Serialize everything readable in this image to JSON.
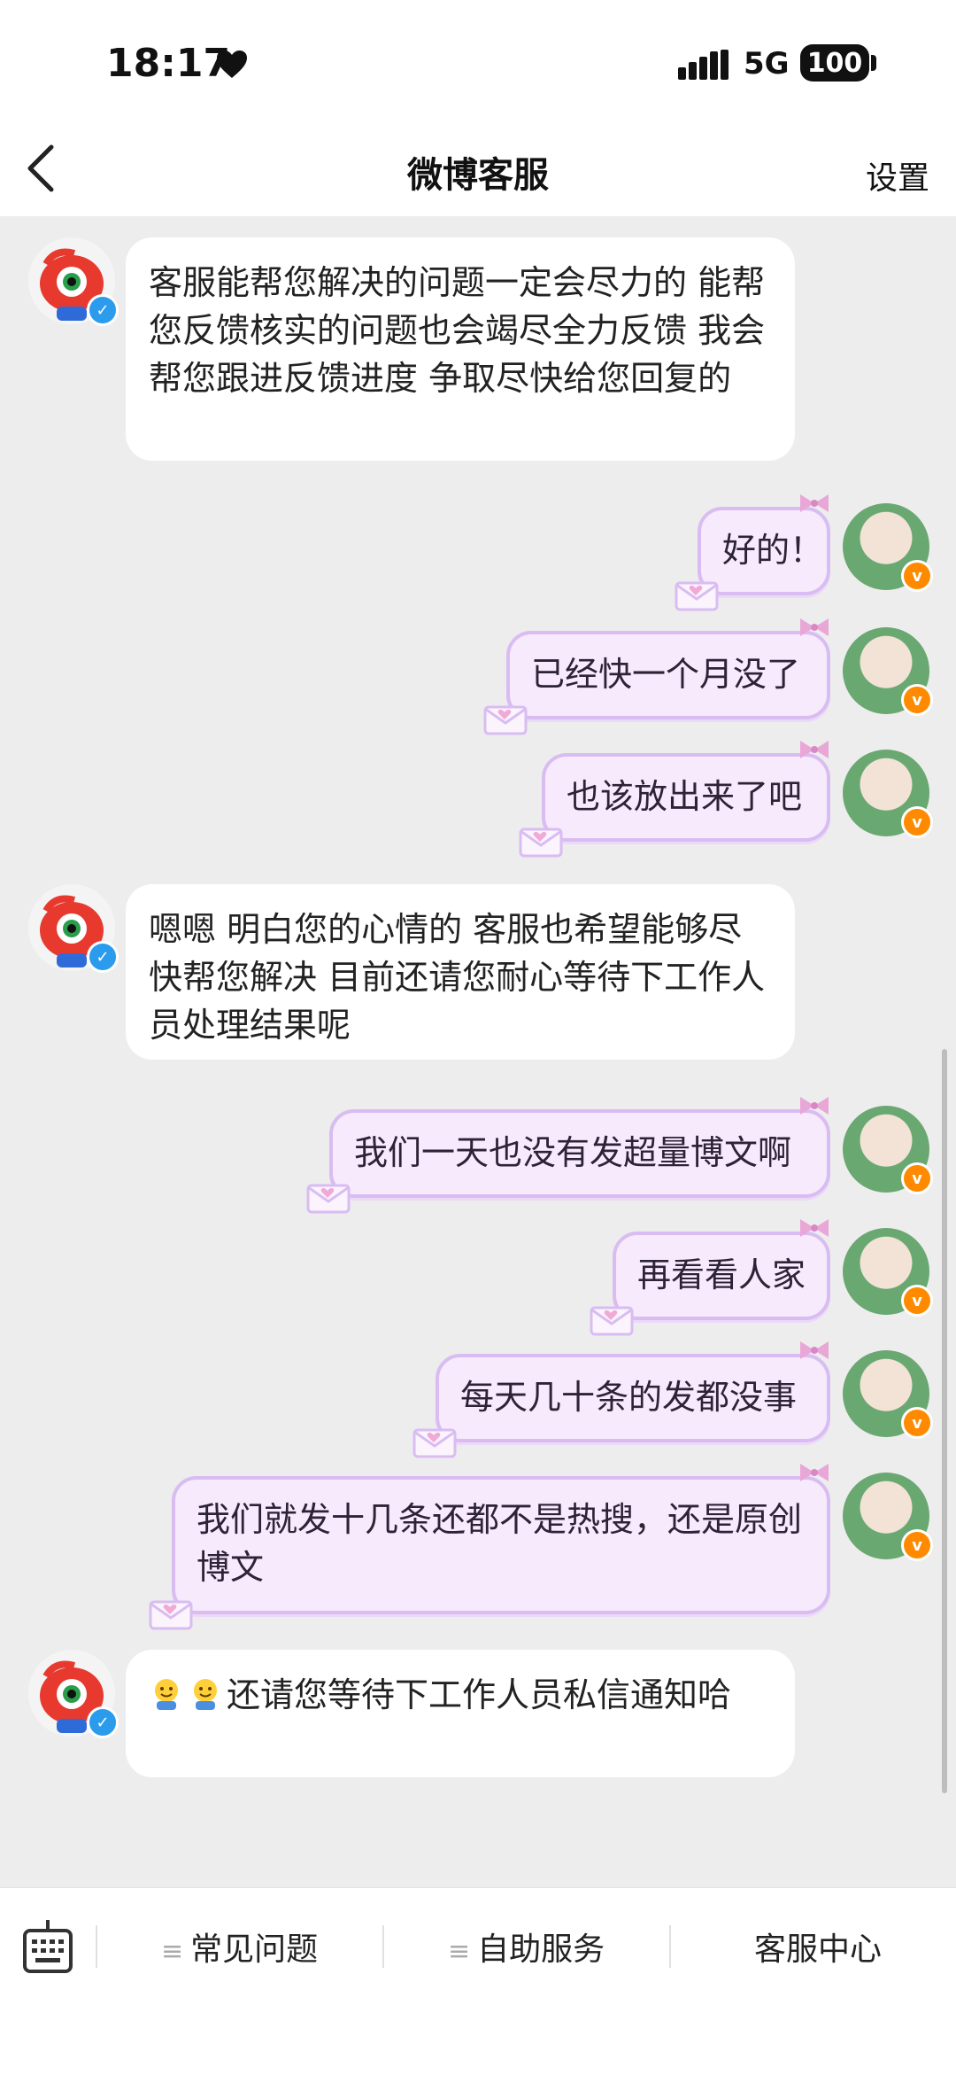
{
  "status_bar": {
    "time": "18:17",
    "network": "5G",
    "battery": "100"
  },
  "nav": {
    "title": "微博客服",
    "settings_label": "设置"
  },
  "messages": [
    {
      "side": "left",
      "text": "客服能帮您解决的问题一定会尽力的 能帮您反馈核实的问题也会竭尽全力反馈 我会帮您跟进反馈进度 争取尽快给您回复的"
    },
    {
      "side": "right",
      "text": "好的！"
    },
    {
      "side": "right",
      "text": "已经快一个月没了"
    },
    {
      "side": "right",
      "text": "也该放出来了吧"
    },
    {
      "side": "left",
      "text": "嗯嗯 明白您的心情的 客服也希望能够尽快帮您解决 目前还请您耐心等待下工作人员处理结果呢"
    },
    {
      "side": "right",
      "text": "我们一天也没有发超量博文啊"
    },
    {
      "side": "right",
      "text": "再看看人家"
    },
    {
      "side": "right",
      "text": "每天几十条的发都没事"
    },
    {
      "side": "right",
      "text": "我们就发十几条还都不是热搜，还是原创博文"
    },
    {
      "side": "left",
      "text": "还请您等待下工作人员私信通知哈",
      "icons": [
        "smiling-face-icon",
        "smiling-face-icon"
      ]
    }
  ],
  "bottom_menu": [
    {
      "label": "常见问题",
      "icon": "menu-lines-icon"
    },
    {
      "label": "自助服务",
      "icon": "menu-lines-icon"
    },
    {
      "label": "客服中心"
    }
  ],
  "colors": {
    "right_bubble_bg": "#f7eafc",
    "right_bubble_border": "#d9bdf2",
    "verified_blue": "#2b9bec",
    "verified_orange": "#ff8a00"
  }
}
